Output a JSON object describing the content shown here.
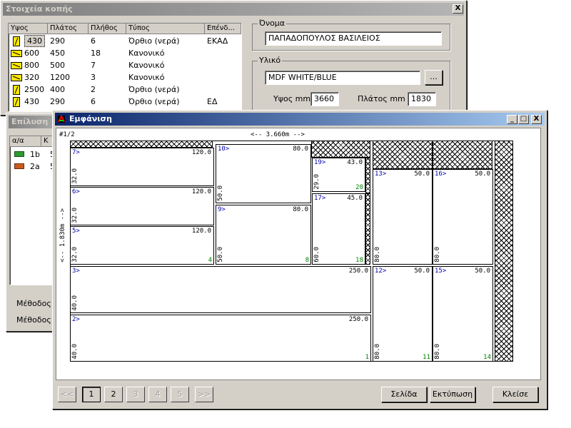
{
  "bg_window": {
    "title": "Στοιχεία κοπής",
    "close_label": "X",
    "list_headers": [
      "Υψος",
      "Πλάτος",
      "Πλήθος",
      "Τύπος",
      "Επένδ..."
    ],
    "rows": [
      {
        "icon": "vertical-board-icon",
        "height": "430",
        "width": "290",
        "count": "6",
        "type": "Όρθιο (νερά)",
        "cover": "ΕΚΑΔ"
      },
      {
        "icon": "horizontal-board-icon",
        "height": "600",
        "width": "450",
        "count": "18",
        "type": "Κανονικό",
        "cover": ""
      },
      {
        "icon": "horizontal-board-icon",
        "height": "800",
        "width": "500",
        "count": "7",
        "type": "Κανονικό",
        "cover": ""
      },
      {
        "icon": "horizontal-board-icon",
        "height": "320",
        "width": "1200",
        "count": "3",
        "type": "Κανονικό",
        "cover": ""
      },
      {
        "icon": "vertical-board-icon",
        "height": "2500",
        "width": "400",
        "count": "2",
        "type": "Όρθιο (νερά)",
        "cover": ""
      },
      {
        "icon": "vertical-board-icon",
        "height": "430",
        "width": "290",
        "count": "6",
        "type": "Όρθιο (νερά)",
        "cover": "ΕΔ"
      }
    ],
    "name_group_label": "Όνομα",
    "name_value": "ΠΑΠΑΔΟΠΟΥΛΟΣ ΒΑΣΙΛΕΙΟΣ",
    "material_group_label": "Υλικό",
    "material_value": "MDF WHITE/BLUE",
    "browse_label": "...",
    "height_label": "Υψος mm",
    "height_value": "3660",
    "width_label": "Πλάτος mm",
    "width_value": "1830"
  },
  "mid_window": {
    "title": "Επίλυση",
    "headers": [
      "α/α",
      "Κ"
    ],
    "rows": [
      {
        "label": "1b",
        "val": "5",
        "color": "#2e9a2e"
      },
      {
        "label": "2a",
        "val": "5",
        "color": "#c85a1e"
      }
    ],
    "method1": "Μέθοδος",
    "method2": "Μέθοδος"
  },
  "view_window": {
    "title": "Εμφάνιση",
    "minimize": "_",
    "maximize": "□",
    "close": "X",
    "sheet_label": "#1/2",
    "width_dim": "<-- 3.660m -->",
    "height_dim": "<-- 1.830m -->",
    "pieces": [
      {
        "id": "7>",
        "w": "120.0",
        "h": "32.0",
        "c": ""
      },
      {
        "id": "6>",
        "w": "120.0",
        "h": "32.0",
        "c": ""
      },
      {
        "id": "5>",
        "w": "120.0",
        "h": "32.0",
        "c": "4"
      },
      {
        "id": "10>",
        "w": "80.0",
        "h": "50.0",
        "c": ""
      },
      {
        "id": "9>",
        "w": "80.0",
        "h": "50.0",
        "c": "8"
      },
      {
        "id": "19>",
        "w": "43.0",
        "h": "29.0",
        "c": "20"
      },
      {
        "id": "17>",
        "w": "45.0",
        "h": "60.0",
        "c": "18"
      },
      {
        "id": "13>",
        "w": "50.0",
        "h": "80.0",
        "c": ""
      },
      {
        "id": "16>",
        "w": "50.0",
        "h": "80.0",
        "c": ""
      },
      {
        "id": "3>",
        "w": "250.0",
        "h": "40.0",
        "c": ""
      },
      {
        "id": "2>",
        "w": "250.0",
        "h": "40.0",
        "c": "1"
      },
      {
        "id": "12>",
        "w": "50.0",
        "h": "80.0",
        "c": "11"
      },
      {
        "id": "15>",
        "w": "50.0",
        "h": "80.0",
        "c": "14"
      }
    ],
    "pages": [
      "<<",
      "1",
      "2",
      "3",
      "4",
      "5",
      ">>"
    ],
    "page_button": "Σελίδα",
    "print_button": "Εκτύπωση",
    "close_button": "Κλείσε"
  }
}
